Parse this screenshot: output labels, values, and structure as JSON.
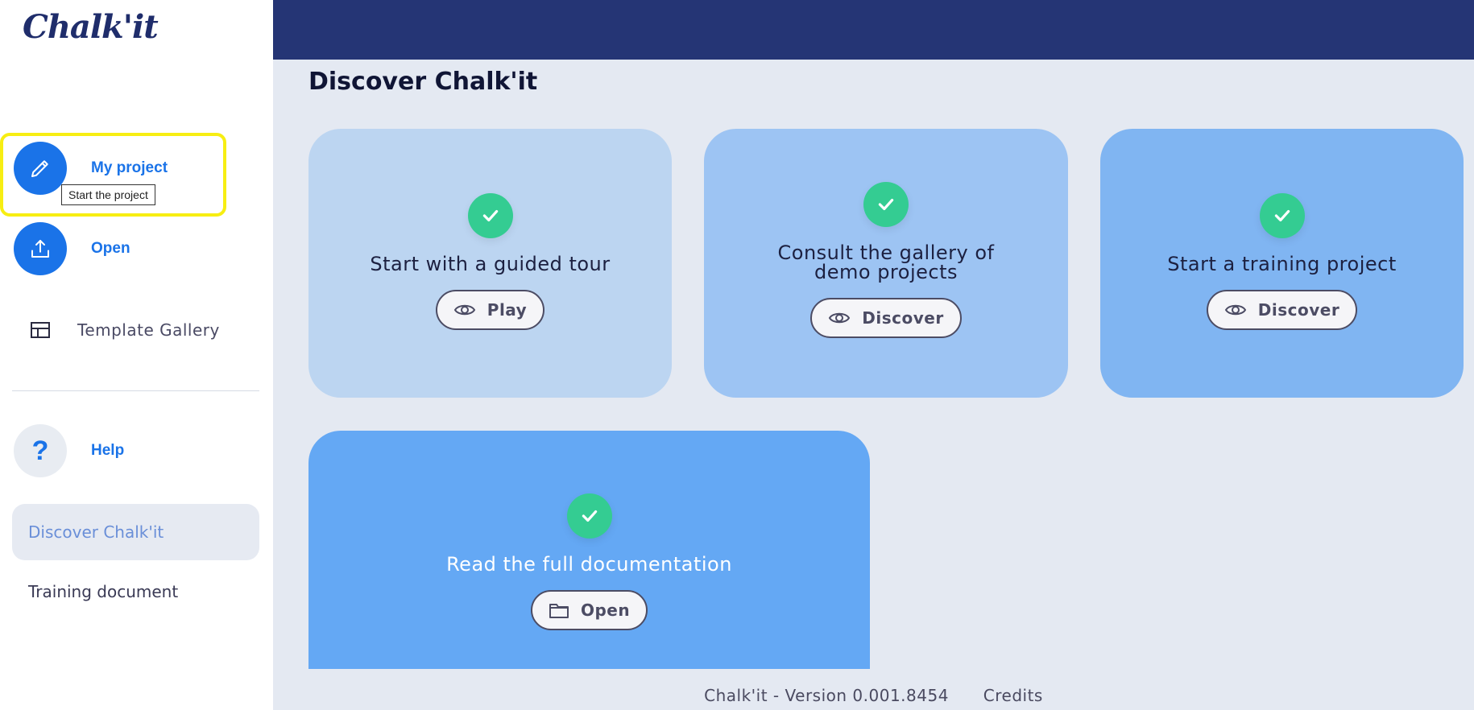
{
  "app": {
    "logo": "Chalk'it"
  },
  "sidebar": {
    "my_project": "My project",
    "tooltip": "Start the project",
    "open": "Open",
    "template_gallery": "Template Gallery",
    "help": "Help",
    "nav": [
      {
        "label": "Discover Chalk'it",
        "active": true
      },
      {
        "label": "Training document",
        "active": false
      }
    ]
  },
  "main": {
    "title": "Discover Chalk'it",
    "cards": [
      {
        "text": "Start with a guided tour",
        "button": "Play",
        "button_icon": "eye-icon"
      },
      {
        "text": "Consult the gallery of demo projects",
        "button": "Discover",
        "button_icon": "eye-icon"
      },
      {
        "text": "Start a training project",
        "button": "Discover",
        "button_icon": "eye-icon"
      },
      {
        "text": "Read the full documentation",
        "button": "Open",
        "button_icon": "folder-icon"
      }
    ]
  },
  "footer": {
    "version": "Chalk'it - Version 0.001.8454",
    "credits": "Credits"
  },
  "colors": {
    "topbar": "#253575",
    "accent_blue": "#1a73e8",
    "check_green": "#34cc92",
    "highlight_yellow": "#f7ee12",
    "card1": "#bcd5f1",
    "card2": "#9dc4f3",
    "card3": "#80b5f2",
    "card4": "#64a8f4"
  }
}
